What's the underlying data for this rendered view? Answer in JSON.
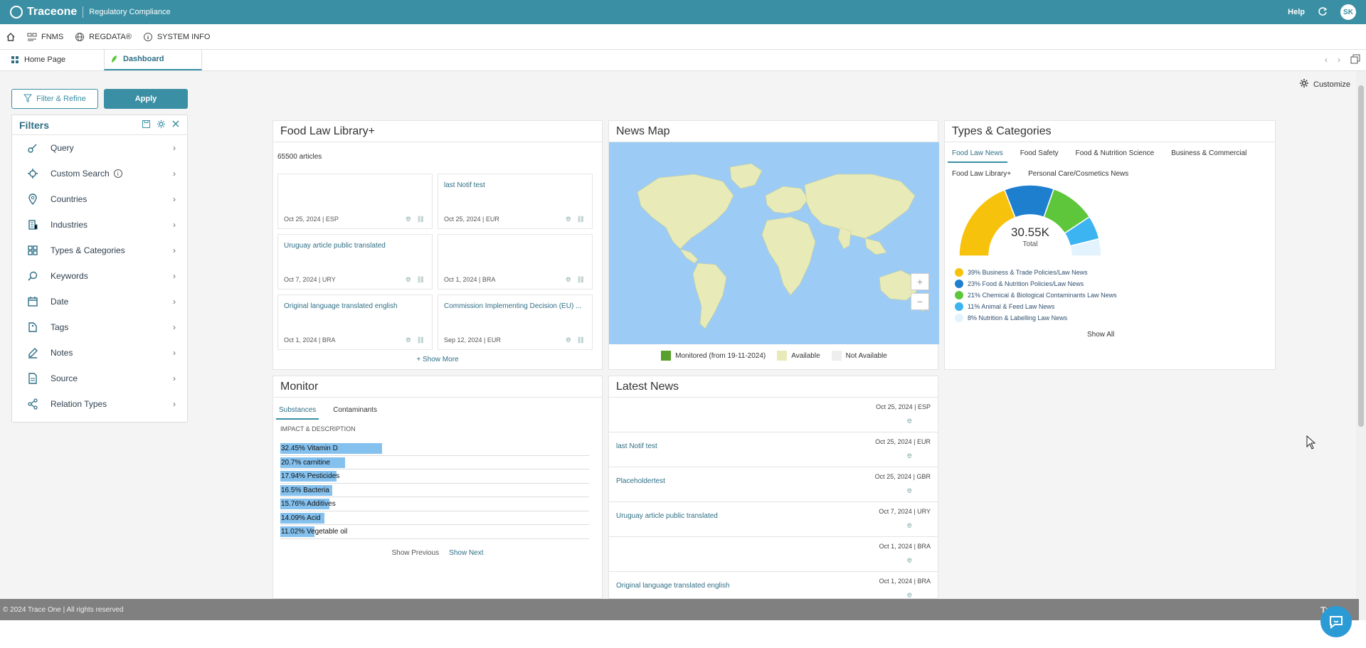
{
  "app": {
    "brand": "Traceone",
    "subtitle": "Regulatory Compliance",
    "help": "Help",
    "user_initials": "SK"
  },
  "menu": {
    "items": [
      {
        "label": "FNMS",
        "icon": "fnms-icon"
      },
      {
        "label": "REGDATA®",
        "icon": "globe-icon"
      },
      {
        "label": "SYSTEM INFO",
        "icon": "info-icon"
      }
    ]
  },
  "tabs": {
    "home": "Home Page",
    "dashboard": "Dashboard"
  },
  "toolbar": {
    "filter_refine": "Filter & Refine",
    "apply": "Apply",
    "customize": "Customize"
  },
  "filters": {
    "title": "Filters",
    "items": [
      {
        "label": "Query",
        "icon": "query-icon"
      },
      {
        "label": "Custom Search",
        "icon": "target-icon"
      },
      {
        "label": "Countries",
        "icon": "location-pin-icon"
      },
      {
        "label": "Industries",
        "icon": "building-icon"
      },
      {
        "label": "Types & Categories",
        "icon": "grid-icon"
      },
      {
        "label": "Keywords",
        "icon": "search-icon"
      },
      {
        "label": "Date",
        "icon": "calendar-icon"
      },
      {
        "label": "Tags",
        "icon": "tag-icon"
      },
      {
        "label": "Notes",
        "icon": "pencil-icon"
      },
      {
        "label": "Source",
        "icon": "document-icon"
      },
      {
        "label": "Relation Types",
        "icon": "share-icon"
      }
    ]
  },
  "food_law": {
    "title": "Food Law Library+",
    "count": "65500 articles",
    "cards": [
      {
        "title": "",
        "meta": "Oct 25, 2024 | ESP"
      },
      {
        "title": "last Notif test",
        "meta": "Oct 25, 2024 | EUR"
      },
      {
        "title": "Uruguay article public translated",
        "meta": "Oct 7, 2024 | URY"
      },
      {
        "title": "",
        "meta": "Oct 1, 2024 | BRA"
      },
      {
        "title": "Original language translated english",
        "meta": "Oct 1, 2024 | BRA"
      },
      {
        "title": "Commission Implementing Decision (EU) ...",
        "meta": "Sep 12, 2024 | EUR"
      }
    ],
    "show_more": "+ Show More"
  },
  "news_map": {
    "title": "News Map",
    "legend": [
      {
        "label": "Monitored (from 19-11-2024)",
        "color": "#5aa02c"
      },
      {
        "label": "Available",
        "color": "#e8ebb7"
      },
      {
        "label": "Not Available",
        "color": "#eeeeee"
      }
    ],
    "zoom_in": "+",
    "zoom_out": "−"
  },
  "types": {
    "title": "Types & Categories",
    "tabs": [
      "Food Law News",
      "Food Safety",
      "Food & Nutrition Science",
      "Business & Commercial",
      "Food Law Library+",
      "Personal Care/Cosmetics News"
    ],
    "total_value": "30.55K",
    "total_label": "Total",
    "segments": [
      {
        "label": "39% Business & Trade Policies/Law News",
        "percent": 39,
        "color": "#f7c20b"
      },
      {
        "label": "23% Food & Nutrition Policies/Law News",
        "percent": 23,
        "color": "#1f7fcf"
      },
      {
        "label": "21% Chemical & Biological Contaminants Law News",
        "percent": 21,
        "color": "#5ec63a"
      },
      {
        "label": "11% Animal & Feed Law News",
        "percent": 11,
        "color": "#3db4f2"
      },
      {
        "label": "8% Nutrition & Labelling Law News",
        "percent": 8,
        "color": "#e3f3fd"
      }
    ],
    "show_all": "Show All"
  },
  "monitor": {
    "title": "Monitor",
    "tabs": [
      "Substances",
      "Contaminants"
    ],
    "header": "IMPACT & DESCRIPTION",
    "bars": [
      {
        "label": "32.45% Vitamin D",
        "percent": 32.45
      },
      {
        "label": "20.7% carnitine",
        "percent": 20.7
      },
      {
        "label": "17.94% Pesticides",
        "percent": 17.94
      },
      {
        "label": "16.5% Bacteria",
        "percent": 16.5
      },
      {
        "label": "15.76% Additives",
        "percent": 15.76
      },
      {
        "label": "14.09% Acid",
        "percent": 14.09
      },
      {
        "label": "11.02% Vegetable oil",
        "percent": 11.02
      }
    ],
    "show_previous": "Show Previous",
    "show_next": "Show Next"
  },
  "latest_news": {
    "title": "Latest News",
    "items": [
      {
        "title": "",
        "meta": "Oct 25, 2024 | ESP"
      },
      {
        "title": "last Notif test",
        "meta": "Oct 25, 2024 | EUR"
      },
      {
        "title": "Placeholdertest",
        "meta": "Oct 25, 2024 | GBR"
      },
      {
        "title": "Uruguay article public translated",
        "meta": "Oct 7, 2024 | URY"
      },
      {
        "title": "",
        "meta": "Oct 1, 2024 | BRA"
      },
      {
        "title": "Original language translated english",
        "meta": "Oct 1, 2024 | BRA"
      }
    ]
  },
  "footer": {
    "copyright": "© 2024 Trace One | All rights reserved",
    "logo": "Trace"
  }
}
